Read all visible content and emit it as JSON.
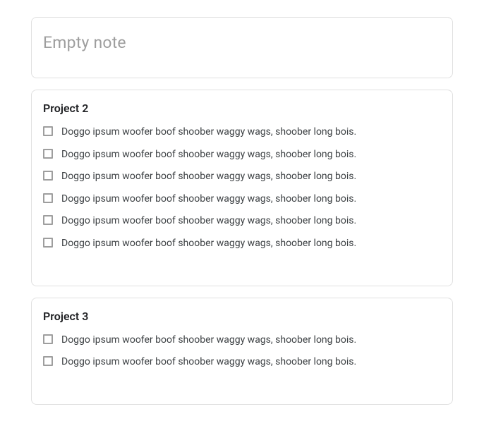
{
  "empty_note": {
    "placeholder": "Empty note"
  },
  "cards": [
    {
      "title": "Project 2",
      "items": [
        "Doggo ipsum woofer boof shoober waggy wags, shoober long bois.",
        "Doggo ipsum woofer boof shoober waggy wags, shoober long bois.",
        "Doggo ipsum woofer boof shoober waggy wags, shoober long bois.",
        "Doggo ipsum woofer boof shoober waggy wags, shoober long bois.",
        "Doggo ipsum woofer boof shoober waggy wags, shoober long bois.",
        "Doggo ipsum woofer boof shoober waggy wags, shoober long bois."
      ]
    },
    {
      "title": "Project 3",
      "items": [
        "Doggo ipsum woofer boof shoober waggy wags, shoober long bois.",
        "Doggo ipsum woofer boof shoober waggy wags, shoober long bois."
      ]
    }
  ]
}
